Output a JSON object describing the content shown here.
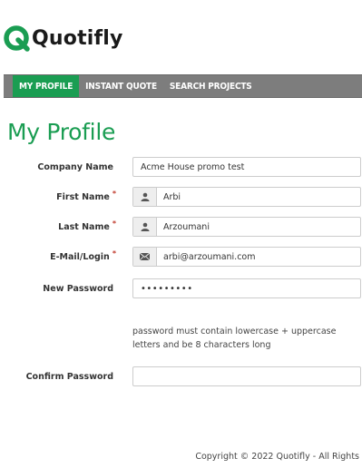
{
  "brand": {
    "name": "Quotifly",
    "accent_color": "#1a9d52"
  },
  "nav": {
    "items": [
      {
        "label": "MY PROFILE",
        "active": true
      },
      {
        "label": "INSTANT QUOTE",
        "active": false
      },
      {
        "label": "SEARCH PROJECTS",
        "active": false
      }
    ]
  },
  "page": {
    "title": "My Profile"
  },
  "form": {
    "company_name": {
      "label": "Company Name",
      "value": "Acme House promo test",
      "required": false
    },
    "first_name": {
      "label": "First Name",
      "value": "Arbi",
      "required": true,
      "icon": "user-icon"
    },
    "last_name": {
      "label": "Last Name",
      "value": "Arzoumani",
      "required": true,
      "icon": "user-icon"
    },
    "email": {
      "label": "E-Mail/Login",
      "value": "arbi@arzoumani.com",
      "required": true,
      "icon": "envelope-icon"
    },
    "new_password": {
      "label": "New Password",
      "value": "•••••••••",
      "required": false
    },
    "password_help": "password must contain lowercase + uppercase letters and be 8 characters long",
    "confirm_password": {
      "label": "Confirm Password",
      "value": "",
      "required": false
    }
  },
  "required_marker": "*",
  "footer": {
    "copyright": "Copyright © 2022 Quotifly - All Rights"
  }
}
